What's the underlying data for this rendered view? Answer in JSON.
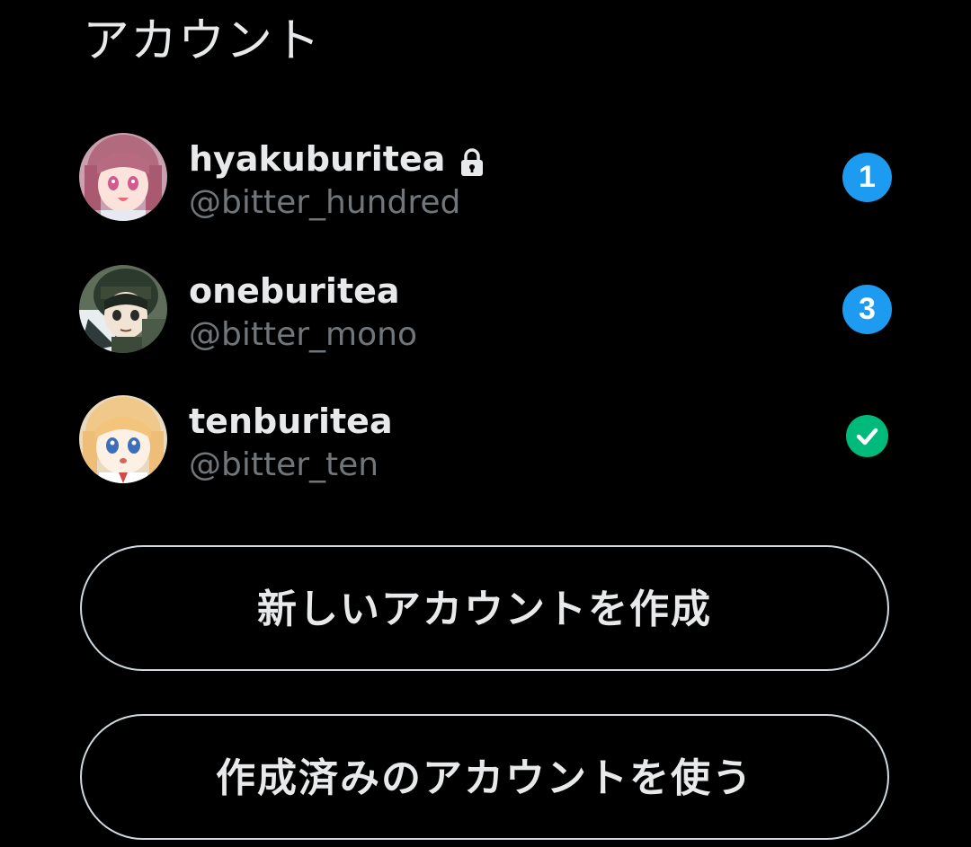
{
  "header": {
    "title": "アカウント"
  },
  "accounts": [
    {
      "display_name": "hyakuburitea",
      "handle": "@bitter_hundred",
      "protected": true,
      "icon": "lock-icon",
      "badge": "1",
      "badge_color": "#1d9bf0"
    },
    {
      "display_name": "oneburitea",
      "handle": "@bitter_mono",
      "protected": false,
      "badge": "3",
      "badge_color": "#1d9bf0"
    },
    {
      "display_name": "tenburitea",
      "handle": "@bitter_ten",
      "protected": false,
      "active": true,
      "icon": "check-icon",
      "badge_color": "#00ba7c"
    }
  ],
  "actions": {
    "create_account_label": "新しいアカウントを作成",
    "use_existing_label": "作成済みのアカウントを使う"
  },
  "colors": {
    "background": "#000000",
    "primary_text": "#e7e9ea",
    "secondary_text": "#71767b",
    "accent": "#1d9bf0",
    "success": "#00ba7c",
    "button_border": "#cfd9de"
  }
}
